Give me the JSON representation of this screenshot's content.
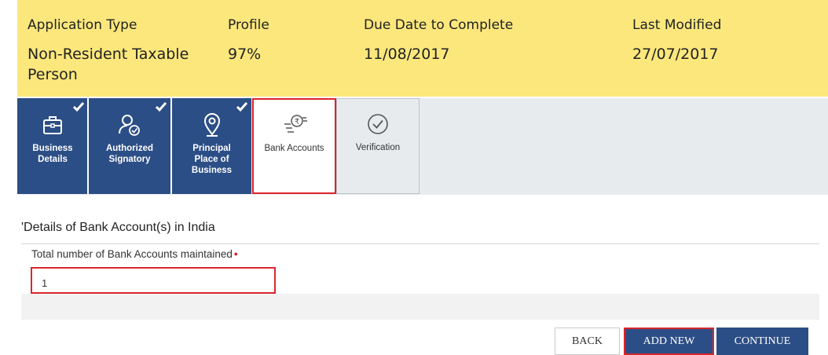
{
  "header": {
    "application_type_label": "Application Type",
    "application_type_value": "Non-Resident Taxable Person",
    "profile_label": "Profile",
    "profile_value": "97%",
    "due_date_label": "Due Date to Complete",
    "due_date_value": "11/08/2017",
    "last_modified_label": "Last Modified",
    "last_modified_value": "27/07/2017"
  },
  "tabs": [
    {
      "label": "Business Details",
      "icon": "briefcase-icon",
      "state": "completed"
    },
    {
      "label": "Authorized Signatory",
      "icon": "person-check-icon",
      "state": "completed"
    },
    {
      "label": "Principal Place of Business",
      "icon": "location-pin-icon",
      "state": "completed"
    },
    {
      "label": "Bank Accounts",
      "icon": "rupee-coin-icon",
      "state": "current"
    },
    {
      "label": "Verification",
      "icon": "checkmark-circle-icon",
      "state": "pending"
    }
  ],
  "section": {
    "title": "'Details of Bank Account(s) in India",
    "field_label": "Total number of Bank Accounts maintained",
    "required_mark": "•",
    "field_value": "1"
  },
  "buttons": {
    "back": "BACK",
    "add_new": "ADD NEW",
    "continue": "CONTINUE"
  },
  "colors": {
    "header_bg": "#fbe77c",
    "tab_done_bg": "#2c4e86",
    "highlight": "#d9262c"
  }
}
